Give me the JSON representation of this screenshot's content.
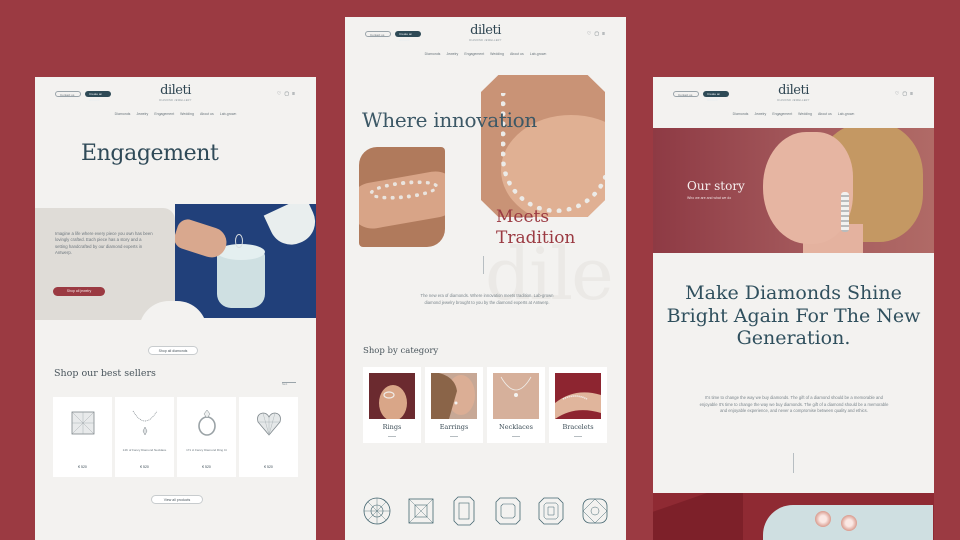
{
  "brand": {
    "logo": "dileti",
    "tagline": "DIAMOND JEWELLERY",
    "pill_left": "Contact us",
    "pill_right": "Create an account",
    "icons": [
      "heart-icon",
      "bag-icon",
      "menu-icon"
    ]
  },
  "nav": [
    "Diamonds",
    "Jewelry",
    "Engagement",
    "Wedding",
    "About us",
    "Lab-grown"
  ],
  "left": {
    "title": "Engagement",
    "intro": "Imagine a life where every piece you own has been lovingly crafted. Each piece has a story and a setting handcrafted by our diamond experts in Antwerp.",
    "cta": "Shop all jewelry",
    "shop_all": "Shop all diamonds",
    "bestsellers_title": "Shop our best sellers",
    "arrow_label": "Next",
    "products": [
      {
        "name": "",
        "price": "€ 520"
      },
      {
        "name": "14K of Fancy Diamond Necklace",
        "price": "€ 520"
      },
      {
        "name": "171 ct Fancy Diamond Ring Ct",
        "price": "€ 520"
      },
      {
        "name": "",
        "price": "€ 520"
      }
    ],
    "view_all": "View all products"
  },
  "mid": {
    "headline_1": "Where innovation",
    "headline_2_a": "Meets",
    "headline_2_b": "Tradition",
    "watermark": "dile",
    "intro": "The new era of diamonds. Where innovation meets tradition. Lab-grown diamond jewelry brought to you by the diamond experts at Antwerp.",
    "shop_by_category": "Shop by category",
    "categories": [
      {
        "label": "Rings"
      },
      {
        "label": "Earrings"
      },
      {
        "label": "Necklaces"
      },
      {
        "label": "Bracelets"
      }
    ],
    "shapes": [
      "round-cut-icon",
      "princess-cut-icon",
      "emerald-cut-icon",
      "radiant-cut-icon",
      "asscher-cut-icon",
      "cushion-cut-icon"
    ]
  },
  "right": {
    "story_title": "Our story",
    "story_sub": "Who we are and what we do",
    "headline": "Make Diamonds Shine Bright Again For The New Generation.",
    "body": "It's time to change the way we buy diamonds. The gift of a diamond should be a memorable and enjoyable It's time to change the way we buy diamonds. The gift of a diamond should be a memorable and enjoyable experience, and never a compromise between quality and ethics."
  },
  "colors": {
    "background": "#9b3a42",
    "panel": "#f3f2f0",
    "accent": "#9b3a42",
    "heading": "#2f4a58"
  }
}
